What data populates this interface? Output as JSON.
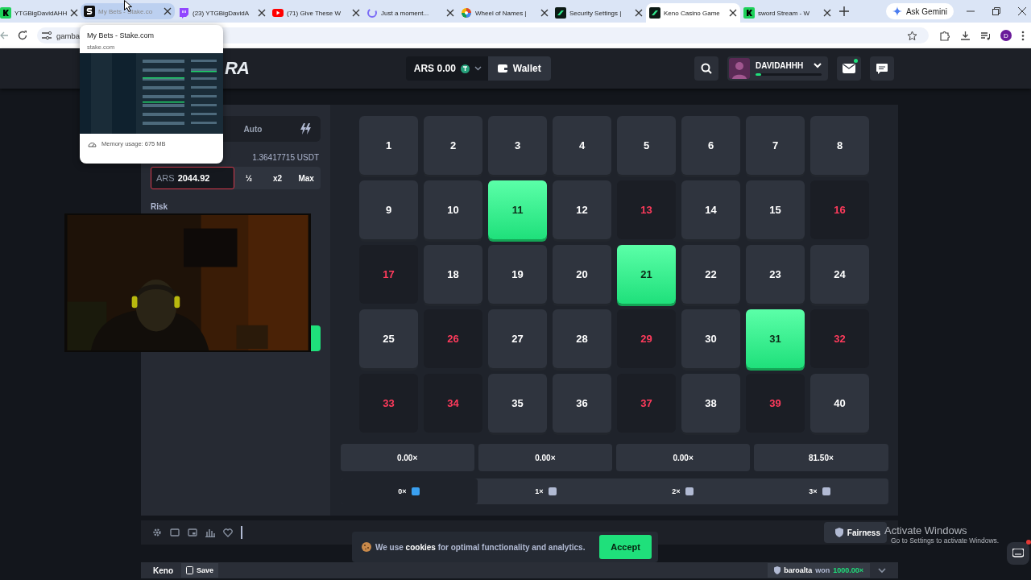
{
  "browser": {
    "tabs": [
      {
        "title": "YTGBigDavidAHH",
        "selected": false,
        "hovered": false
      },
      {
        "title": "My Bets - Stake.co",
        "selected": false,
        "hovered": true
      },
      {
        "title": "(23) YTGBigDavidA",
        "selected": false,
        "hovered": false
      },
      {
        "title": "(71) Give These W",
        "selected": false,
        "hovered": false
      },
      {
        "title": "Just a moment...",
        "selected": false,
        "hovered": false
      },
      {
        "title": "Wheel of Names |",
        "selected": false,
        "hovered": false
      },
      {
        "title": "Security Settings |",
        "selected": false,
        "hovered": false
      },
      {
        "title": "Keno Casino Game",
        "selected": true,
        "hovered": false
      },
      {
        "title": "sword Stream - W",
        "selected": false,
        "hovered": false
      }
    ],
    "ask_button": "Ask Gemini",
    "address": "gamba",
    "profile_initial": "D",
    "tab_preview": {
      "title": "My Bets - Stake.com",
      "domain": "stake.com",
      "memory": "Memory usage: 675 MB"
    }
  },
  "header": {
    "logo": "RA",
    "balance": "ARS 0.00",
    "wallet": "Wallet",
    "username": "DAVIDAHHH",
    "level": 0.08
  },
  "controls": {
    "mode_tabs": [
      {
        "label": "Auto",
        "selected": false
      }
    ],
    "balance_hint": "1.36417715 USDT",
    "bet": {
      "currency": "ARS",
      "amount": "2044.92"
    },
    "bet_buttons": [
      "½",
      "x2",
      "Max"
    ],
    "risk_label": "Risk"
  },
  "board": {
    "tiles": [
      {
        "n": "1",
        "kind": "idle"
      },
      {
        "n": "2",
        "kind": "idle"
      },
      {
        "n": "3",
        "kind": "idle"
      },
      {
        "n": "4",
        "kind": "idle"
      },
      {
        "n": "5",
        "kind": "idle"
      },
      {
        "n": "6",
        "kind": "idle"
      },
      {
        "n": "7",
        "kind": "idle"
      },
      {
        "n": "8",
        "kind": "idle"
      },
      {
        "n": "9",
        "kind": "idle"
      },
      {
        "n": "10",
        "kind": "idle"
      },
      {
        "n": "11",
        "kind": "hit"
      },
      {
        "n": "12",
        "kind": "idle"
      },
      {
        "n": "13",
        "kind": "miss"
      },
      {
        "n": "14",
        "kind": "idle"
      },
      {
        "n": "15",
        "kind": "idle"
      },
      {
        "n": "16",
        "kind": "miss"
      },
      {
        "n": "17",
        "kind": "miss"
      },
      {
        "n": "18",
        "kind": "idle"
      },
      {
        "n": "19",
        "kind": "idle"
      },
      {
        "n": "20",
        "kind": "idle"
      },
      {
        "n": "21",
        "kind": "hit"
      },
      {
        "n": "22",
        "kind": "idle"
      },
      {
        "n": "23",
        "kind": "idle"
      },
      {
        "n": "24",
        "kind": "idle"
      },
      {
        "n": "25",
        "kind": "idle"
      },
      {
        "n": "26",
        "kind": "miss"
      },
      {
        "n": "27",
        "kind": "idle"
      },
      {
        "n": "28",
        "kind": "idle"
      },
      {
        "n": "29",
        "kind": "miss"
      },
      {
        "n": "30",
        "kind": "idle"
      },
      {
        "n": "31",
        "kind": "hit"
      },
      {
        "n": "32",
        "kind": "miss"
      },
      {
        "n": "33",
        "kind": "miss"
      },
      {
        "n": "34",
        "kind": "miss"
      },
      {
        "n": "35",
        "kind": "idle"
      },
      {
        "n": "36",
        "kind": "idle"
      },
      {
        "n": "37",
        "kind": "miss"
      },
      {
        "n": "38",
        "kind": "idle"
      },
      {
        "n": "39",
        "kind": "miss"
      },
      {
        "n": "40",
        "kind": "idle"
      }
    ],
    "payouts": [
      "0.00×",
      "0.00×",
      "0.00×",
      "81.50×"
    ],
    "hits": [
      {
        "label": "0×",
        "selected": true
      },
      {
        "label": "1×",
        "selected": false
      },
      {
        "label": "2×",
        "selected": false
      },
      {
        "label": "3×",
        "selected": false
      }
    ]
  },
  "footer": {
    "fairness": "Fairness"
  },
  "cookie_banner": {
    "text": "We use **cookies** for optimal functionality and analytics.",
    "accept": "Accept"
  },
  "strip": {
    "game": "Keno",
    "save": "Save",
    "player": "baroalta",
    "verb": "won",
    "amount": "1000.00×"
  },
  "os_notice": {
    "title": "Activate Windows",
    "hint": "Go to Settings to activate Windows."
  }
}
